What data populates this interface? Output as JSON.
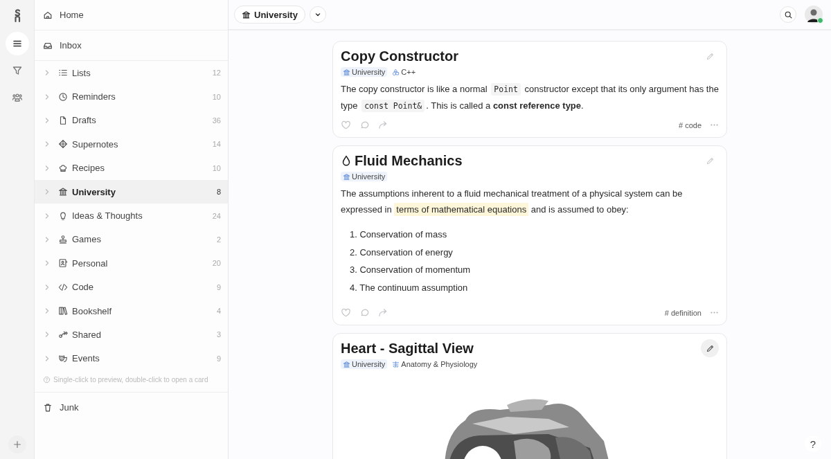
{
  "sidebar": {
    "top_items": [
      {
        "label": "Home",
        "selected": false
      },
      {
        "label": "Inbox",
        "selected": false
      }
    ],
    "items": [
      {
        "label": "Lists",
        "count": "12",
        "selected": false,
        "expanded": false
      },
      {
        "label": "Reminders",
        "count": "10",
        "selected": false,
        "expanded": false
      },
      {
        "label": "Drafts",
        "count": "36",
        "selected": false,
        "expanded": false
      },
      {
        "label": "Supernotes",
        "count": "14",
        "selected": false,
        "expanded": false
      },
      {
        "label": "Recipes",
        "count": "10",
        "selected": false,
        "expanded": false
      },
      {
        "label": "University",
        "count": "8",
        "selected": true,
        "expanded": false
      },
      {
        "label": "Ideas & Thoughts",
        "count": "24",
        "selected": false,
        "expanded": false
      },
      {
        "label": "Games",
        "count": "2",
        "selected": false,
        "expanded": false
      },
      {
        "label": "Personal",
        "count": "20",
        "selected": false,
        "expanded": false
      },
      {
        "label": "Code",
        "count": "9",
        "selected": false,
        "expanded": false
      },
      {
        "label": "Bookshelf",
        "count": "4",
        "selected": false,
        "expanded": false
      },
      {
        "label": "Shared",
        "count": "3",
        "selected": false,
        "expanded": false
      },
      {
        "label": "Events",
        "count": "9",
        "selected": false,
        "expanded": false
      }
    ],
    "hint": "Single-click to preview, double-click to open a card",
    "junk": "Junk"
  },
  "rail": {
    "items": [
      {
        "selected": true
      },
      {
        "selected": false
      },
      {
        "selected": false
      }
    ]
  },
  "topbar": {
    "title": "University",
    "online": true
  },
  "cards": [
    {
      "title": "Copy Constructor",
      "edit_active": false,
      "tags": [
        {
          "label": "University",
          "highlighted": true
        },
        {
          "label": "C++",
          "highlighted": false
        }
      ],
      "body": [
        {
          "kind": "paragraph",
          "segments": [
            {
              "kind": "plain",
              "text": "The copy constructor is like a normal "
            },
            {
              "kind": "code",
              "text": "Point"
            },
            {
              "kind": "plain",
              "text": " constructor except that its only argument has the type "
            },
            {
              "kind": "code",
              "text": "const Point&"
            },
            {
              "kind": "plain",
              "text": ". This is called a **const reference type**."
            }
          ]
        }
      ],
      "hashtag": "# code"
    },
    {
      "title": "Fluid Mechanics",
      "edit_active": false,
      "tags": [
        {
          "label": "University",
          "highlighted": true
        }
      ],
      "body": [
        {
          "kind": "paragraph",
          "segments": [
            {
              "kind": "plain",
              "text": "The assumptions inherent to a fluid mechanical treatment of a physical system can be expressed in "
            },
            {
              "kind": "highlight",
              "text": "terms of mathematical equations"
            },
            {
              "kind": "plain",
              "text": " and is assumed to obey:"
            }
          ]
        },
        {
          "kind": "list",
          "items": [
            "1. Conservation of mass",
            "2. Conservation of energy",
            "3. Conservation of momentum",
            "4. The continuum assumption"
          ]
        }
      ],
      "hashtag": "# definition"
    },
    {
      "title": "Heart - Sagittal View",
      "edit_active": true,
      "tags": [
        {
          "label": "University",
          "highlighted": true
        },
        {
          "label": "Anatomy & Physiology",
          "highlighted": false
        }
      ],
      "body": [
        {
          "kind": "picture"
        }
      ]
    }
  ],
  "help": "?"
}
